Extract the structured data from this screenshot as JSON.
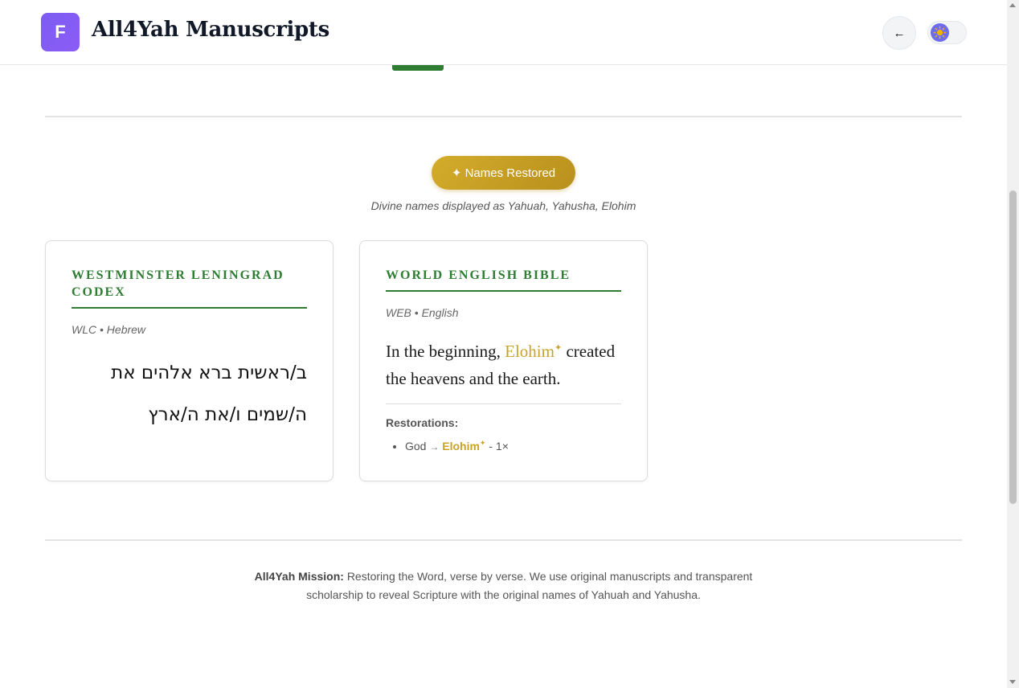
{
  "header": {
    "logo_letter": "F",
    "title": "All4Yah Manuscripts",
    "back_label": "←",
    "theme_icon": "sun-icon"
  },
  "names_toggle": {
    "label": "✦ Names Restored",
    "note": "Divine names displayed as Yahuah, Yahusha, Elohim"
  },
  "cards": [
    {
      "title": "Westminster Leningrad Codex",
      "meta": "WLC • Hebrew",
      "text": "ב/ראשית ברא אלהים את ה/שמים ו/את ה/ארץ"
    },
    {
      "title": "World English Bible",
      "meta": "WEB • English",
      "text_before": "In the beginning,",
      "restored_name": "Elohim",
      "star": "✦",
      "text_after": "created the heavens and the earth.",
      "restorations_label": "Restorations:",
      "restorations": [
        {
          "original": "God",
          "arrow": "→",
          "restored": "Elohim",
          "star": "✦",
          "count": "- 1×"
        }
      ]
    }
  ],
  "footer": {
    "mission_label": "All4Yah Mission:",
    "mission_text": "Restoring the Word, verse by verse. We use original manuscripts and transparent scholarship to reveal Scripture with the original names of Yahuah and Yahusha."
  },
  "colors": {
    "accent_green": "#2e7d32",
    "gold": "#c9a227",
    "logo_purple": "#8b5cf6"
  }
}
